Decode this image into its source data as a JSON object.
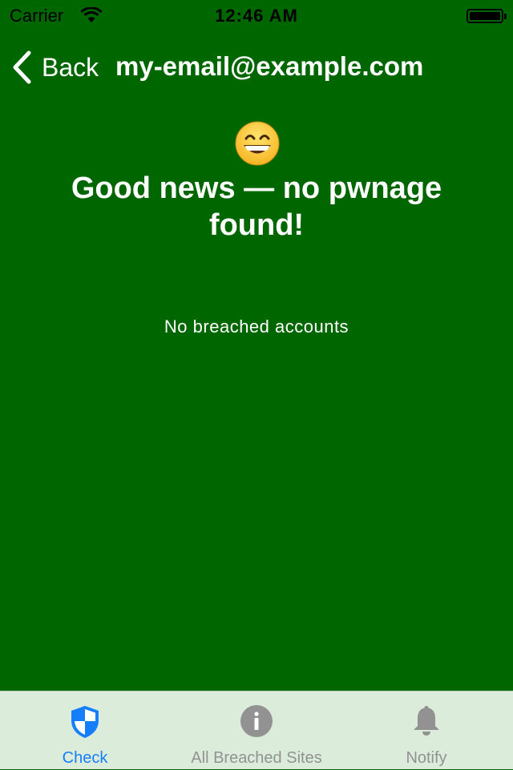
{
  "status_bar": {
    "carrier": "Carrier",
    "time": "12:46 AM",
    "wifi_icon": "wifi-icon",
    "battery_icon": "battery-icon"
  },
  "nav": {
    "back_label": "Back",
    "title": "my-email@example.com",
    "back_icon": "chevron-left-icon"
  },
  "result": {
    "emoji": "smiling-face-icon",
    "headline": "Good news — no pwnage found!",
    "subtext": "No breached accounts"
  },
  "tabs": [
    {
      "label": "Check",
      "icon": "shield-icon",
      "selected": true
    },
    {
      "label": "All Breached Sites",
      "icon": "info-icon",
      "selected": false
    },
    {
      "label": "Notify",
      "icon": "bell-icon",
      "selected": false
    }
  ],
  "colors": {
    "background": "#006600",
    "tab_bar": "#dbecdb",
    "tab_active": "#157efb",
    "tab_inactive": "#929292"
  }
}
